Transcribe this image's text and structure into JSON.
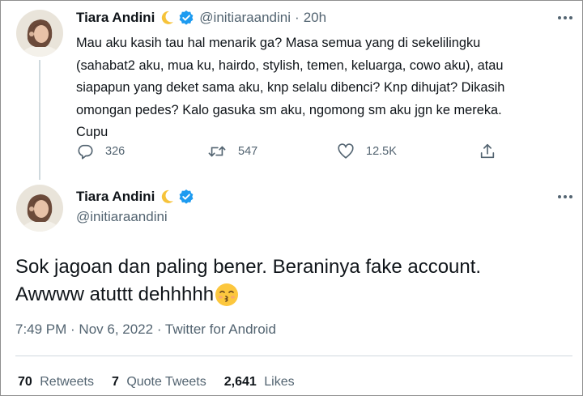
{
  "first_tweet": {
    "author_name": "Tiara Andini",
    "author_handle": "@initiaraandini",
    "separator": "·",
    "relative_time": "20h",
    "text_lines": [
      "Mau aku kasih tau hal menarik ga? Masa semua yang di sekelilingku",
      "(sahabat2 aku, mua ku, hairdo, stylish, temen, keluarga, cowo aku), atau",
      "siapapun yang deket sama aku, knp selalu dibenci? Knp dihujat? Dikasih",
      "omongan pedes? Kalo gasuka sm aku, ngomong sm aku jgn ke mereka.",
      "Cupu"
    ],
    "actions": {
      "reply_count": "326",
      "retweet_count": "547",
      "like_count": "12.5K"
    }
  },
  "second_tweet": {
    "author_name": "Tiara Andini",
    "author_handle": "@initiaraandini",
    "text_line_1": "Sok jagoan dan paling bener. Beraninya fake account.",
    "text_line_2": "Awwww atuttt dehhhhh",
    "timestamp": "7:49 PM · Nov 6, 2022 · Twitter for Android",
    "stats": [
      {
        "count": "70",
        "label": "Retweets"
      },
      {
        "count": "7",
        "label": "Quote Tweets"
      },
      {
        "count": "2,641",
        "label": "Likes"
      }
    ]
  },
  "icons": {
    "verified": "verified-badge-icon",
    "moon": "crescent-moon-emoji",
    "emoji": "kissing-face-emoji",
    "reply": "reply-icon",
    "retweet": "retweet-icon",
    "like": "heart-icon",
    "share": "share-icon",
    "more": "more-options-icon"
  },
  "colors": {
    "text": "#0f1419",
    "secondary": "#536471",
    "verified_blue": "#1d9bf0",
    "divider": "#cfd9de"
  }
}
